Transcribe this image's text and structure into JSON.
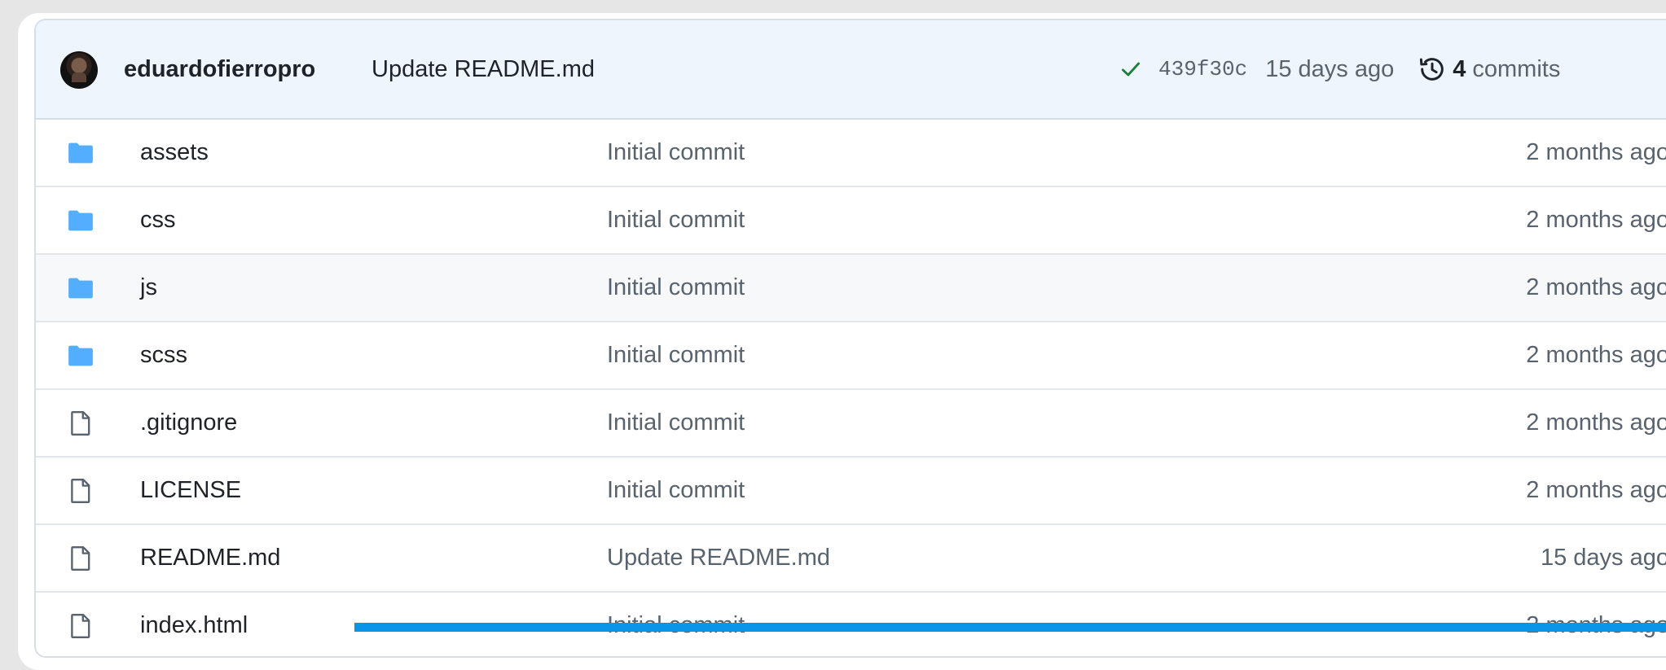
{
  "latest_commit": {
    "author": "eduardofierropro",
    "message": "Update README.md",
    "sha": "439f30c",
    "time": "15 days ago",
    "commits_count": "4",
    "commits_label": "commits",
    "status_color": "#1a7f37"
  },
  "files": [
    {
      "type": "folder",
      "icon": "folder-icon",
      "name": "assets",
      "message": "Initial commit",
      "date": "2 months ago"
    },
    {
      "type": "folder",
      "icon": "folder-icon",
      "name": "css",
      "message": "Initial commit",
      "date": "2 months ago"
    },
    {
      "type": "folder",
      "icon": "folder-icon",
      "name": "js",
      "message": "Initial commit",
      "date": "2 months ago"
    },
    {
      "type": "folder",
      "icon": "folder-icon",
      "name": "scss",
      "message": "Initial commit",
      "date": "2 months ago"
    },
    {
      "type": "file",
      "icon": "file-icon",
      "name": ".gitignore",
      "message": "Initial commit",
      "date": "2 months ago"
    },
    {
      "type": "file",
      "icon": "file-icon",
      "name": "LICENSE",
      "message": "Initial commit",
      "date": "2 months ago"
    },
    {
      "type": "file",
      "icon": "file-icon",
      "name": "README.md",
      "message": "Update README.md",
      "date": "15 days ago"
    },
    {
      "type": "file",
      "icon": "file-icon",
      "name": "index.html",
      "message": "Initial commit",
      "date": "2 months ago"
    }
  ],
  "colors": {
    "folder": "#54aeff",
    "header_bg": "#eef5fd",
    "overlay_bar": "#0a95e8"
  }
}
